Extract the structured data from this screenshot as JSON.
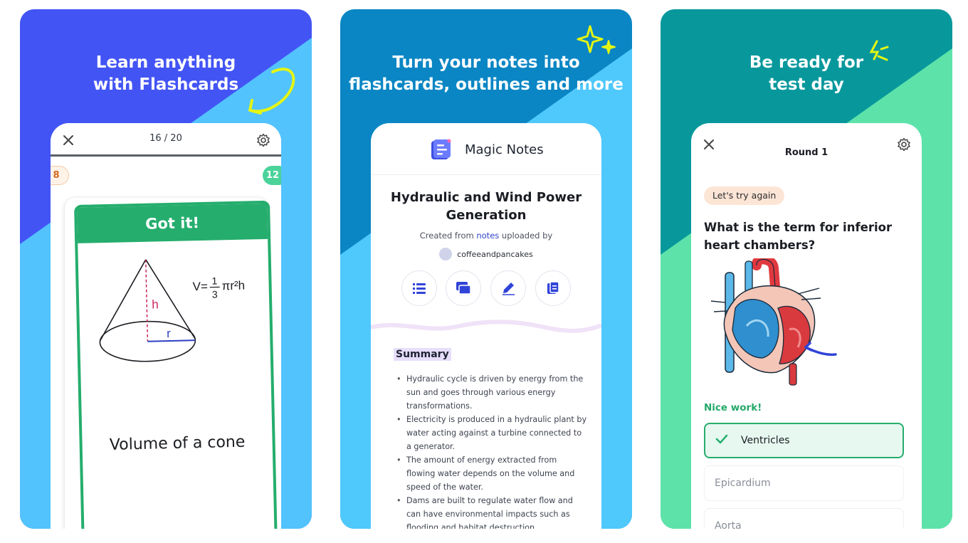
{
  "colors": {
    "panel1_bg": "#4354f5",
    "panel1_bottom": "#53c3fd",
    "panel2_bg": "#0a86c4",
    "panel2_bottom": "#4fc8fc",
    "panel3_bg": "#08989c",
    "panel3_bottom": "#5de3aa",
    "accent_yellow": "#e4f514",
    "green": "#25ad6d"
  },
  "panel1": {
    "headline_line1": "Learn anything",
    "headline_line2": "with Flashcards",
    "progress": "16 / 20",
    "left_count": "8",
    "right_count": "12",
    "card_header": "Got it!",
    "formula_prefix": "V=",
    "formula_num": "1",
    "formula_den": "3",
    "formula_suffix": "πr²h",
    "label_h": "h",
    "label_r": "r",
    "card_text": "Volume of a cone",
    "icons": [
      "close-icon",
      "gear-icon"
    ]
  },
  "panel2": {
    "headline_line1": "Turn your notes into",
    "headline_line2": "flashcards, outlines and more",
    "app_title": "Magic Notes",
    "doc_title_line1": "Hydraulic and Wind Power",
    "doc_title_line2": "Generation",
    "created_prefix": "Created from ",
    "created_link": "notes",
    "created_suffix": " uploaded by",
    "username": "coffeeandpancakes",
    "action_icons": [
      "list-icon",
      "flashcards-icon",
      "pencil-icon",
      "document-icon"
    ],
    "summary_label": "Summary",
    "bullets": [
      "Hydraulic cycle is driven by energy from the sun and goes through various energy transformations.",
      "Electricity is produced in a hydraulic plant by water acting against a turbine connected to a generator.",
      "The amount of energy extracted from flowing water depends on the volume and speed of the water.",
      "Dams are built to regulate water flow and can have environmental impacts such as flooding and habitat destruction."
    ]
  },
  "panel3": {
    "headline_line1": "Be ready for",
    "headline_line2": "test day",
    "round_title": "Round 1",
    "retry_badge": "Let's try again",
    "question": "What is the term for inferior heart chambers?",
    "feedback": "Nice work!",
    "options": [
      {
        "label": "Ventricles",
        "state": "correct"
      },
      {
        "label": "Epicardium",
        "state": "default"
      },
      {
        "label": "Aorta",
        "state": "default"
      }
    ],
    "icons": [
      "close-icon",
      "gear-icon",
      "check-icon",
      "heart-illustration",
      "arrow-icon"
    ]
  }
}
